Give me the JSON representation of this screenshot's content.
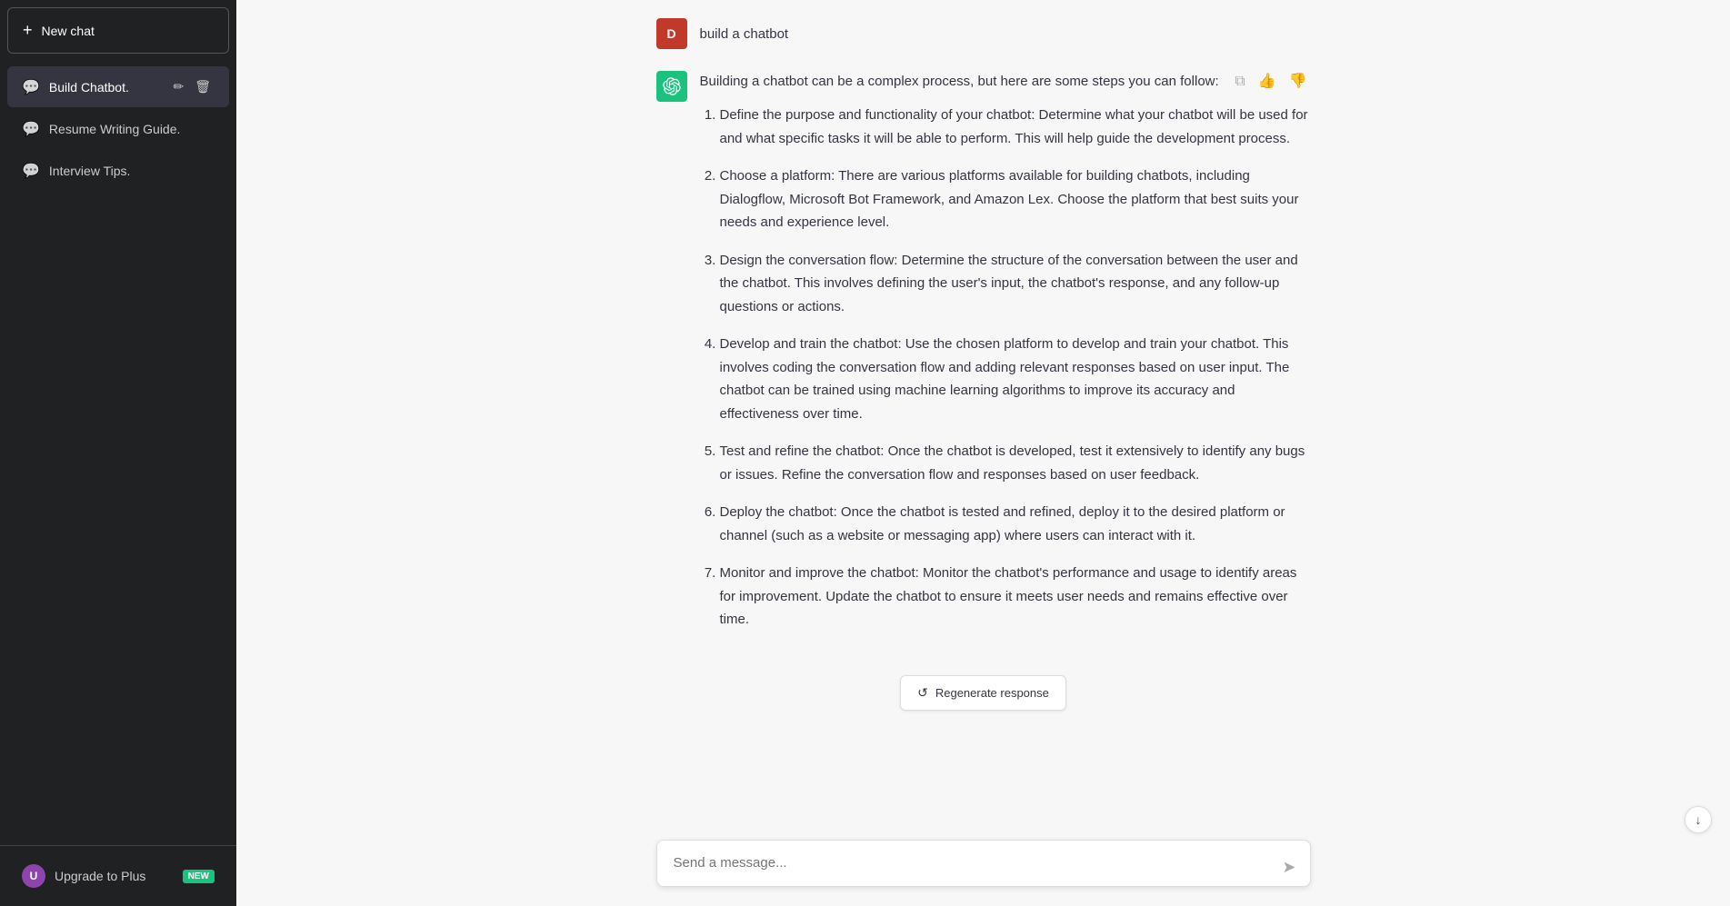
{
  "sidebar": {
    "new_chat_label": "New chat",
    "items": [
      {
        "id": "build-chatbot",
        "label": "Build Chatbot.",
        "active": true
      },
      {
        "id": "resume-writing",
        "label": "Resume Writing Guide.",
        "active": false
      },
      {
        "id": "interview-tips",
        "label": "Interview Tips.",
        "active": false
      }
    ],
    "upgrade_label": "Upgrade to Plus",
    "new_badge": "NEW",
    "user_initial": "U"
  },
  "chat": {
    "user_initial": "D",
    "user_message": "build a chatbot",
    "ai_intro": "Building a chatbot can be a complex process, but here are some steps you can follow:",
    "steps": [
      {
        "num": 1,
        "text": "Define the purpose and functionality of your chatbot: Determine what your chatbot will be used for and what specific tasks it will be able to perform. This will help guide the development process."
      },
      {
        "num": 2,
        "text": "Choose a platform: There are various platforms available for building chatbots, including Dialogflow, Microsoft Bot Framework, and Amazon Lex. Choose the platform that best suits your needs and experience level."
      },
      {
        "num": 3,
        "text": "Design the conversation flow: Determine the structure of the conversation between the user and the chatbot. This involves defining the user's input, the chatbot's response, and any follow-up questions or actions."
      },
      {
        "num": 4,
        "text": "Develop and train the chatbot: Use the chosen platform to develop and train your chatbot. This involves coding the conversation flow and adding relevant responses based on user input. The chatbot can be trained using machine learning algorithms to improve its accuracy and effectiveness over time."
      },
      {
        "num": 5,
        "text": "Test and refine the chatbot: Once the chatbot is developed, test it extensively to identify any bugs or issues. Refine the conversation flow and responses based on user feedback."
      },
      {
        "num": 6,
        "text": "Deploy the chatbot: Once the chatbot is tested and refined, deploy it to the desired platform or channel (such as a website or messaging app) where users can interact with it."
      },
      {
        "num": 7,
        "text": "Monitor and improve the chatbot: Monitor the chatbot's performance and usage to identify areas for improvement. Update the chatbot to ensure it meets user needs and remains effective over time."
      }
    ],
    "regenerate_label": "Regenerate response",
    "input_placeholder": "Send a message..."
  },
  "icons": {
    "plus": "+",
    "chat": "💬",
    "pencil": "✏",
    "trash": "🗑",
    "copy": "⧉",
    "thumbup": "👍",
    "thumbdown": "👎",
    "regen": "↺",
    "send": "➤",
    "scrolldown": "↓"
  }
}
